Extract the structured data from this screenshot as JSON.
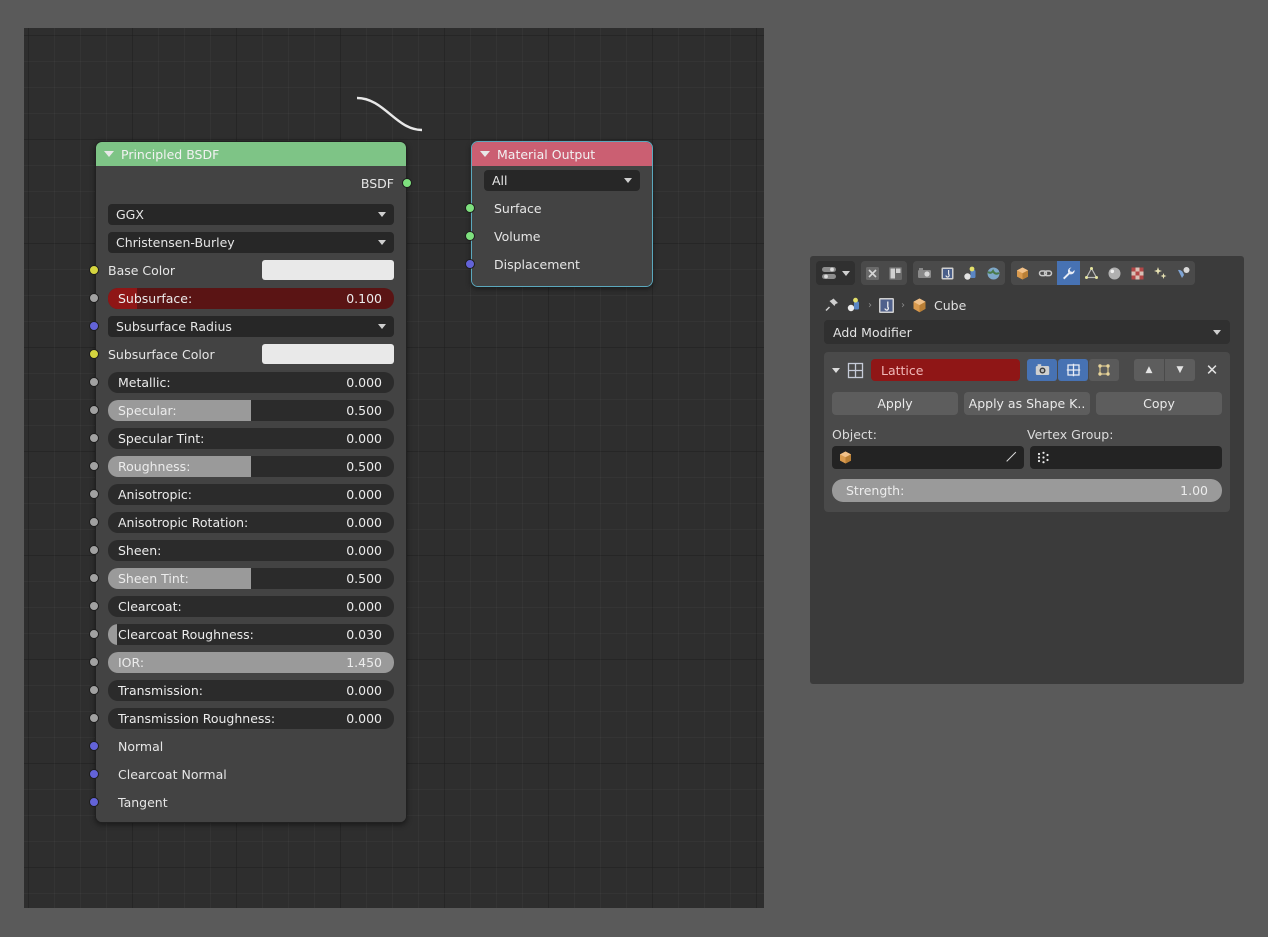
{
  "node_editor": {
    "nodes": {
      "principled": {
        "title": "Principled BSDF",
        "output_socket_label": "BSDF",
        "distribution": "GGX",
        "subsurface_method": "Christensen-Burley",
        "inputs": [
          {
            "label": "Base Color",
            "type": "color",
            "socket": "yellow",
            "swatch": "#e9e9e9"
          },
          {
            "label": "Subsurface:",
            "type": "slider",
            "value": "0.100",
            "fill": 10,
            "socket": "gray",
            "style": "red"
          },
          {
            "label": "Subsurface Radius",
            "type": "dropdown",
            "socket": "purple"
          },
          {
            "label": "Subsurface Color",
            "type": "color",
            "socket": "yellow",
            "swatch": "#e9e9e9"
          },
          {
            "label": "Metallic:",
            "type": "slider",
            "value": "0.000",
            "fill": 0,
            "socket": "gray"
          },
          {
            "label": "Specular:",
            "type": "slider",
            "value": "0.500",
            "fill": 50,
            "socket": "gray"
          },
          {
            "label": "Specular Tint:",
            "type": "slider",
            "value": "0.000",
            "fill": 0,
            "socket": "gray"
          },
          {
            "label": "Roughness:",
            "type": "slider",
            "value": "0.500",
            "fill": 50,
            "socket": "gray"
          },
          {
            "label": "Anisotropic:",
            "type": "slider",
            "value": "0.000",
            "fill": 0,
            "socket": "gray"
          },
          {
            "label": "Anisotropic Rotation:",
            "type": "slider",
            "value": "0.000",
            "fill": 0,
            "socket": "gray"
          },
          {
            "label": "Sheen:",
            "type": "slider",
            "value": "0.000",
            "fill": 0,
            "socket": "gray"
          },
          {
            "label": "Sheen Tint:",
            "type": "slider",
            "value": "0.500",
            "fill": 50,
            "socket": "gray"
          },
          {
            "label": "Clearcoat:",
            "type": "slider",
            "value": "0.000",
            "fill": 0,
            "socket": "gray"
          },
          {
            "label": "Clearcoat Roughness:",
            "type": "slider",
            "value": "0.030",
            "fill": 3,
            "socket": "gray"
          },
          {
            "label": "IOR:",
            "type": "slider",
            "value": "1.450",
            "fill": 100,
            "socket": "gray"
          },
          {
            "label": "Transmission:",
            "type": "slider",
            "value": "0.000",
            "fill": 0,
            "socket": "gray"
          },
          {
            "label": "Transmission Roughness:",
            "type": "slider",
            "value": "0.000",
            "fill": 0,
            "socket": "gray"
          },
          {
            "label": "Normal",
            "type": "plain",
            "socket": "purple"
          },
          {
            "label": "Clearcoat Normal",
            "type": "plain",
            "socket": "purple"
          },
          {
            "label": "Tangent",
            "type": "plain",
            "socket": "purple"
          }
        ]
      },
      "material_output": {
        "title": "Material Output",
        "target": "All",
        "inputs": [
          {
            "label": "Surface",
            "socket": "green"
          },
          {
            "label": "Volume",
            "socket": "green"
          },
          {
            "label": "Displacement",
            "socket": "purple"
          }
        ]
      }
    }
  },
  "properties": {
    "editor_type_icon": "properties-editor-icon",
    "tool_tabs": [
      {
        "name": "tool-tab",
        "icon": "tool-icon"
      },
      {
        "name": "render-tab",
        "icon": "render-icon"
      }
    ],
    "scene_tabs": [
      {
        "name": "output-tab",
        "icon": "printer-icon"
      },
      {
        "name": "view-layer-tab",
        "icon": "images-icon"
      },
      {
        "name": "scene-tab",
        "icon": "scene-icon"
      },
      {
        "name": "world-tab",
        "icon": "world-icon"
      }
    ],
    "object_tabs": [
      {
        "name": "object-tab",
        "icon": "cube-icon",
        "active": false
      },
      {
        "name": "constraints-tab",
        "icon": "chain-icon",
        "active": false
      },
      {
        "name": "modifiers-tab",
        "icon": "wrench-icon",
        "active": true
      },
      {
        "name": "data-tab",
        "icon": "mesh-data-icon",
        "active": false
      },
      {
        "name": "material-tab",
        "icon": "sphere-icon",
        "active": false
      },
      {
        "name": "texture-tab",
        "icon": "checker-icon",
        "active": false
      },
      {
        "name": "particles-tab",
        "icon": "sparkles-icon",
        "active": false
      },
      {
        "name": "physics-tab",
        "icon": "physics-icon",
        "active": false
      }
    ],
    "breadcrumb": {
      "pin_icon": "pin-icon",
      "scene_icon": "scene-spheres-icon",
      "data_icon": "modifier-data-icon",
      "object_icon": "cube-icon",
      "object_name": "Cube",
      "separator": "›"
    },
    "add_modifier_label": "Add Modifier",
    "modifier": {
      "expand_icon": "chevron-down-icon",
      "type_icon": "lattice-icon",
      "name": "Lattice",
      "toggles": [
        {
          "name": "render-visibility-toggle",
          "icon": "camera-icon",
          "on": true
        },
        {
          "name": "realtime-visibility-toggle",
          "icon": "lattice-grid-icon",
          "on": true
        },
        {
          "name": "edit-mode-toggle",
          "icon": "edit-mode-icon",
          "on": false
        }
      ],
      "move_up_label": "▲",
      "move_down_label": "▼",
      "close_label": "✕",
      "buttons": [
        {
          "name": "apply-button",
          "label": "Apply"
        },
        {
          "name": "apply-as-shape-key-button",
          "label": "Apply as Shape K.."
        },
        {
          "name": "copy-button",
          "label": "Copy"
        }
      ],
      "object_label": "Object:",
      "vertex_group_label": "Vertex Group:",
      "object_value": "",
      "object_icon": "cube-icon",
      "object_picker_icon": "eyedropper-icon",
      "vertex_group_value": "",
      "vertex_group_icon": "vertex-group-icon",
      "strength_label": "Strength:",
      "strength_value": "1.00",
      "strength_fill": 100
    }
  }
}
